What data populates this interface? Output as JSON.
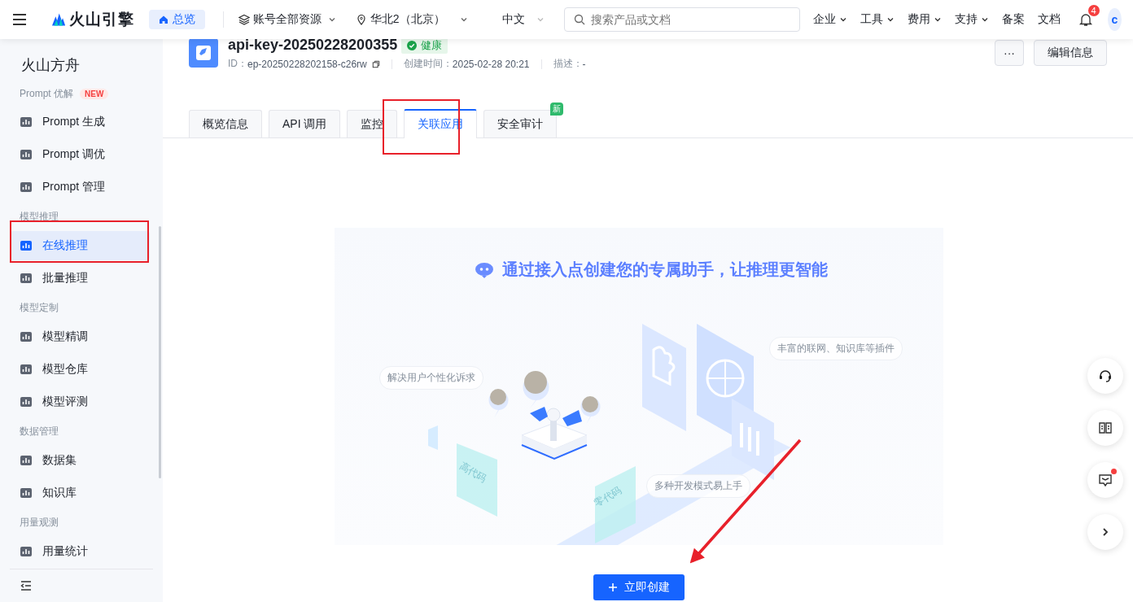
{
  "topbar": {
    "brand": "火山引擎",
    "home": "总览",
    "account_scope": "账号全部资源",
    "region": "华北2（北京）",
    "language": "中文",
    "search": {
      "placeholder": "搜索产品或文档"
    },
    "nav_menus": [
      "企业",
      "工具",
      "费用",
      "支持"
    ],
    "nav_links": [
      "备案",
      "文档"
    ],
    "notification_count": "4",
    "avatar": "c"
  },
  "sidebar": {
    "title": "火山方舟",
    "sections": [
      {
        "heading": "Prompt 优解",
        "badge": "NEW",
        "items": [
          {
            "label": "Prompt 生成",
            "selected": false
          },
          {
            "label": "Prompt 调优",
            "selected": false
          },
          {
            "label": "Prompt 管理",
            "selected": false
          }
        ]
      },
      {
        "heading": "模型推理",
        "items": [
          {
            "label": "在线推理",
            "selected": true
          },
          {
            "label": "批量推理",
            "selected": false
          }
        ]
      },
      {
        "heading": "模型定制",
        "items": [
          {
            "label": "模型精调",
            "selected": false
          },
          {
            "label": "模型仓库",
            "selected": false
          },
          {
            "label": "模型评测",
            "selected": false
          }
        ]
      },
      {
        "heading": "数据管理",
        "items": [
          {
            "label": "数据集",
            "selected": false
          },
          {
            "label": "知识库",
            "selected": false
          }
        ]
      },
      {
        "heading": "用量观测",
        "items": [
          {
            "label": "用量统计",
            "selected": false
          }
        ]
      }
    ]
  },
  "endpoint": {
    "name": "api-key-20250228200355",
    "status": "健康",
    "id": {
      "label": "ID：",
      "value": "ep-20250228202158-c26rw"
    },
    "meta": [
      {
        "label": "创建时间：",
        "value": "2025-02-28 20:21"
      },
      {
        "label": "描述：",
        "value": "-"
      }
    ],
    "more_button": "···",
    "edit_button": "编辑信息"
  },
  "tabs": [
    {
      "label": "概览信息",
      "selected": false
    },
    {
      "label": "API 调用",
      "selected": false
    },
    {
      "label": "监控",
      "selected": false
    },
    {
      "label": "关联应用",
      "selected": true
    },
    {
      "label": "安全审计",
      "selected": false,
      "badge": "新"
    }
  ],
  "empty_state": {
    "headline": "通过接入点创建您的专属助手，让推理更智能",
    "features": [
      "解决用户个性化诉求",
      "丰富的联网、知识库等插件",
      "多种开发模式易上手"
    ],
    "code_cards": [
      "高代码",
      "零代码"
    ],
    "create_button": "立即创建"
  }
}
